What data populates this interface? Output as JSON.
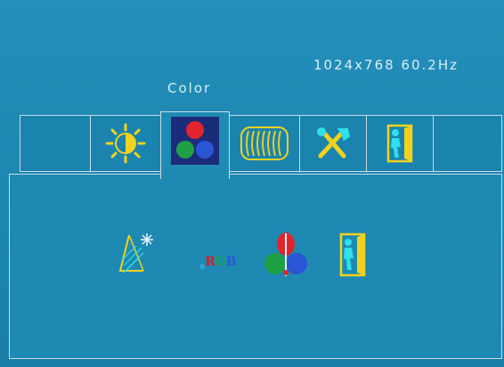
{
  "header": {
    "resolution": "1024x768 60.2Hz",
    "menu_title": "Color"
  },
  "tabs": [
    {
      "id": "blank-left",
      "icon": "none"
    },
    {
      "id": "brightness",
      "icon": "brightness-icon"
    },
    {
      "id": "color",
      "icon": "color-dots-icon",
      "active": true
    },
    {
      "id": "image",
      "icon": "wave-image-icon"
    },
    {
      "id": "tools",
      "icon": "tools-icon"
    },
    {
      "id": "exit",
      "icon": "exit-door-icon"
    },
    {
      "id": "blank-right",
      "icon": "none"
    }
  ],
  "color_panel": {
    "items": [
      {
        "id": "color-temperature",
        "icon": "color-temperature-icon"
      },
      {
        "id": "srgb",
        "icon": "srgb-icon",
        "label_s": "s",
        "label_r": "R",
        "label_g": "G",
        "label_b": "B"
      },
      {
        "id": "user-color",
        "icon": "rgb-user-color-icon"
      },
      {
        "id": "exit",
        "icon": "exit-door-icon"
      }
    ]
  },
  "colors": {
    "background": "#1e89b3",
    "border": "#c9dbe3",
    "icon_yellow": "#f2d21d",
    "icon_cyan": "#2ee0e8",
    "red": "#e0262c",
    "green": "#1ea043",
    "blue": "#2a56d6"
  }
}
